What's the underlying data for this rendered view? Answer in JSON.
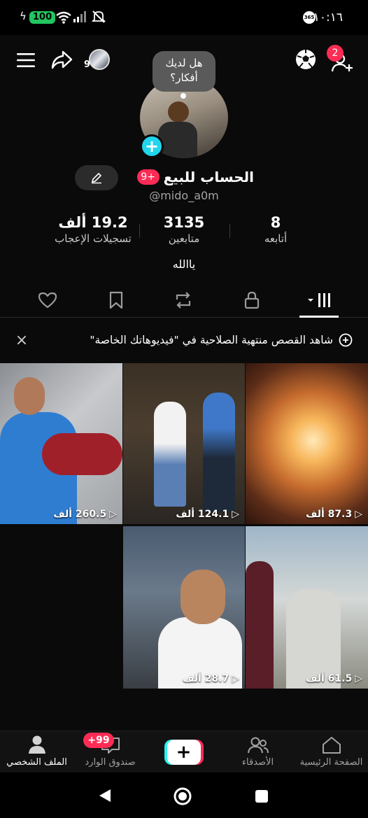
{
  "status_bar": {
    "battery": "100",
    "time": "١٠:١٦"
  },
  "top_bar": {
    "story_count": "9",
    "notification_count": "2"
  },
  "profile": {
    "bubble_text_1": "هل لديك",
    "bubble_text_2": "أفكار؟",
    "name": "الحساب للبيع",
    "name_badge": "+9",
    "username": "@mido_a0m",
    "bio": "ياالله"
  },
  "stats": [
    {
      "value": "19.2 ألف",
      "label": "تسجيلات الإعجاب"
    },
    {
      "value": "3135",
      "label": "متابعين"
    },
    {
      "value": "8",
      "label": "أتابعه"
    }
  ],
  "banner": {
    "text": "شاهد القصص منتهية الصلاحية في \"فيديوهاتك الخاصة\""
  },
  "videos": [
    {
      "views": "87.3 ألف"
    },
    {
      "views": "124.1 ألف"
    },
    {
      "views": "260.5 ألف"
    },
    {
      "views": "61.5 ألف"
    },
    {
      "views": "28.7 ألف"
    }
  ],
  "bottom_nav": {
    "home": "الصفحة الرئيسية",
    "friends": "الأصدقاء",
    "inbox": "صندوق الوارد",
    "inbox_badge": "+99",
    "profile": "الملف الشخصي"
  }
}
